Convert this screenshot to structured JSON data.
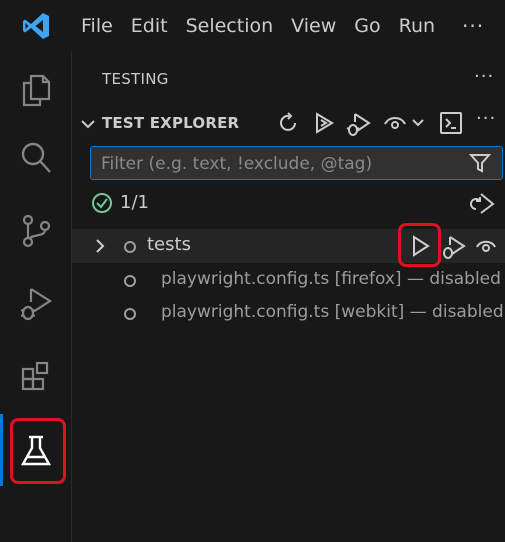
{
  "menu": {
    "file": "File",
    "edit": "Edit",
    "selection": "Selection",
    "view": "View",
    "go": "Go",
    "run": "Run",
    "more": "···"
  },
  "activity_bar": {
    "items": [
      "explorer",
      "search",
      "source-control",
      "run-and-debug",
      "extensions",
      "testing"
    ],
    "active": "testing"
  },
  "panel": {
    "title": "TESTING",
    "more": "···"
  },
  "section": {
    "title": "TEST EXPLORER",
    "more": "···"
  },
  "filter": {
    "placeholder": "Filter (e.g. text, !exclude, @tag)",
    "value": ""
  },
  "status": {
    "result": "1/1"
  },
  "tree": {
    "root_label": "tests",
    "children": [
      {
        "name": "playwright.config.ts [firefox] — disabled"
      },
      {
        "name": "playwright.config.ts [webkit] — disabled"
      }
    ]
  },
  "colors": {
    "accent": "#0078d4",
    "highlight": "#e01020",
    "success": "#73c991",
    "logo": "#3ca4f0"
  }
}
